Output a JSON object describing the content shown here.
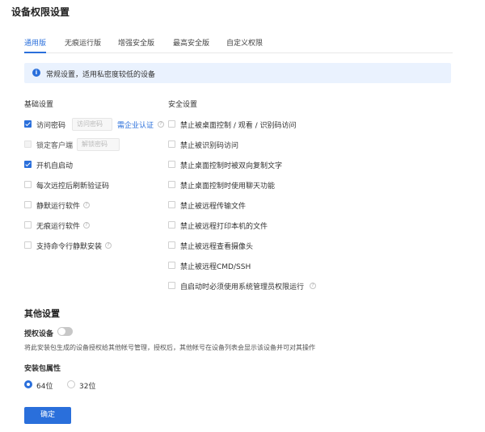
{
  "page_title": "设备权限设置",
  "tabs": [
    {
      "label": "通用版",
      "active": true
    },
    {
      "label": "无痕运行版",
      "active": false
    },
    {
      "label": "增强安全版",
      "active": false
    },
    {
      "label": "最高安全版",
      "active": false
    },
    {
      "label": "自定义权限",
      "active": false
    }
  ],
  "notice": {
    "icon": "info-icon",
    "text": "常规设置，适用私密度较低的设备"
  },
  "basic": {
    "title": "基础设置",
    "items": [
      {
        "label": "访问密码",
        "checked": true,
        "input_placeholder": "访问密码",
        "link": "需企业认证",
        "help": true
      },
      {
        "label": "锁定客户端",
        "checked": false,
        "disabled": true,
        "input_placeholder": "解锁密码"
      },
      {
        "label": "开机自启动",
        "checked": true
      },
      {
        "label": "每次远控后刷新验证码",
        "checked": false
      },
      {
        "label": "静默运行软件",
        "checked": false,
        "help": true
      },
      {
        "label": "无痕运行软件",
        "checked": false,
        "help": true
      },
      {
        "label": "支持命令行静默安装",
        "checked": false,
        "help": true
      }
    ]
  },
  "security": {
    "title": "安全设置",
    "items": [
      {
        "label": "禁止被桌面控制 / 观看 / 识别码访问",
        "checked": false
      },
      {
        "label": "禁止被识别码访问",
        "checked": false
      },
      {
        "label": "禁止桌面控制时被双向复制文字",
        "checked": false
      },
      {
        "label": "禁止桌面控制时使用聊天功能",
        "checked": false
      },
      {
        "label": "禁止被远程传输文件",
        "checked": false
      },
      {
        "label": "禁止被远程打印本机的文件",
        "checked": false
      },
      {
        "label": "禁止被远程查看摄像头",
        "checked": false
      },
      {
        "label": "禁止被远程CMD/SSH",
        "checked": false
      },
      {
        "label": "自启动时必须使用系统管理员权限运行",
        "checked": false,
        "help": true
      }
    ]
  },
  "other": {
    "title": "其他设置",
    "authorize_label": "授权设备",
    "authorize_on": false,
    "description": "将此安装包生成的设备授权给其他帐号管理，授权后，其他帐号在设备列表会显示该设备并可对其操作",
    "package_label": "安装包属性",
    "radios": [
      {
        "label": "64位",
        "checked": true
      },
      {
        "label": "32位",
        "checked": false
      }
    ]
  },
  "confirm_label": "确定",
  "colors": {
    "accent": "#2a6fdb",
    "notice_bg": "#eaf2fe"
  }
}
